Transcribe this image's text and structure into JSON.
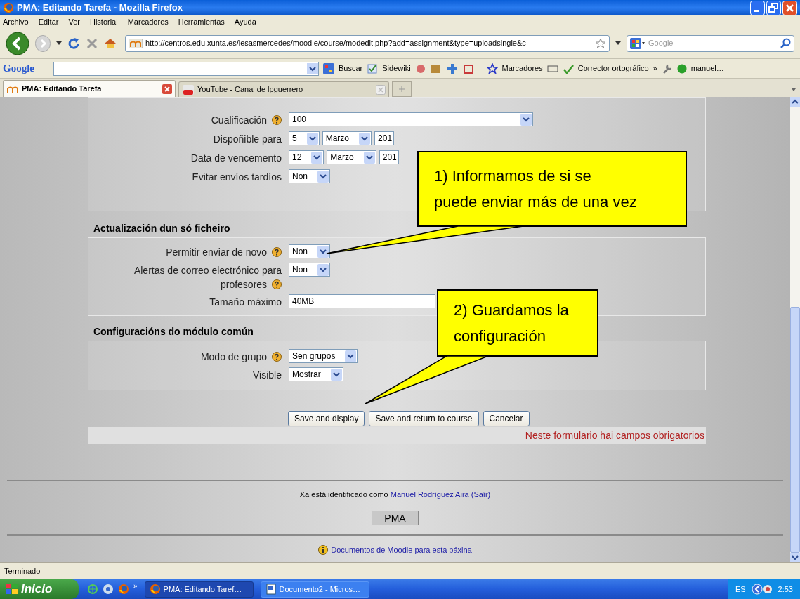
{
  "window": {
    "title": "PMA: Editando Tarefa - Mozilla Firefox"
  },
  "menu": [
    "Archivo",
    "Editar",
    "Ver",
    "Historial",
    "Marcadores",
    "Herramientas",
    "Ayuda"
  ],
  "address": {
    "value": "http://centros.edu.xunta.es/iesasmercedes/moodle/course/modedit.php?add=assignment&type=uploadsingle&c"
  },
  "search": {
    "placeholder": "Google"
  },
  "google_toolbar": {
    "logo": "Google",
    "items": [
      "Buscar",
      "Sidewiki",
      "Marcadores",
      "Corrector ortográfico",
      "»",
      "manuel…"
    ]
  },
  "tabs": [
    {
      "label": "PMA: Editando Tarefa",
      "selected": true
    },
    {
      "label": "YouTube - Canal de lpguerrero",
      "selected": false
    }
  ],
  "form": {
    "sections": [
      {
        "rows": [
          {
            "label": "Cualificación",
            "help": true,
            "fields": [
              {
                "kind": "wide-select",
                "value": "100"
              }
            ]
          },
          {
            "label": "Dispoñible para",
            "help": false,
            "fields": [
              {
                "kind": "select",
                "value": "5"
              },
              {
                "kind": "select",
                "value": "Marzo"
              },
              {
                "kind": "covered-select",
                "value": "201"
              }
            ]
          },
          {
            "label": "Data de vencemento",
            "help": false,
            "fields": [
              {
                "kind": "select",
                "value": "12"
              },
              {
                "kind": "select",
                "value": "Marzo"
              },
              {
                "kind": "covered-select",
                "value": "201"
              }
            ]
          },
          {
            "label": "Evitar envíos tardíos",
            "help": false,
            "fields": [
              {
                "kind": "select",
                "value": "Non"
              }
            ]
          }
        ]
      },
      {
        "heading": "Actualización dun só ficheiro",
        "rows": [
          {
            "label": "Permitir enviar de novo",
            "help": true,
            "fields": [
              {
                "kind": "select",
                "value": "Non"
              }
            ]
          },
          {
            "label": "Alertas de correo electrónico para profesores",
            "help": true,
            "fields": [
              {
                "kind": "select",
                "value": "Non"
              }
            ]
          },
          {
            "label": "Tamaño máximo",
            "help": false,
            "fields": [
              {
                "kind": "long-select",
                "value": "40MB"
              }
            ]
          }
        ]
      },
      {
        "heading": "Configuracións do módulo común",
        "rows": [
          {
            "label": "Modo de grupo",
            "help": true,
            "fields": [
              {
                "kind": "select",
                "value": "Sen grupos"
              }
            ]
          },
          {
            "label": "Visible",
            "help": false,
            "fields": [
              {
                "kind": "select",
                "value": "Mostrar"
              }
            ]
          }
        ]
      }
    ],
    "buttons": [
      "Save and display",
      "Save and return to course",
      "Cancelar"
    ],
    "required_note": "Neste formulario hai campos obrigatorios"
  },
  "footer": {
    "login_prefix": "Xa está identificado como",
    "user": "Manuel Rodríguez Aira",
    "logout": "(Saír)",
    "home_button": "PMA",
    "docs_link": "Documentos de Moodle para esta páxina"
  },
  "callouts": [
    {
      "lines": [
        "1) Informamos de si se",
        "puede enviar más de una vez"
      ]
    },
    {
      "lines": [
        "2) Guardamos la",
        "configuración"
      ]
    }
  ],
  "status_bar": "Terminado",
  "taskbar": {
    "start": "Inicio",
    "more": "»",
    "tasks": [
      {
        "label": "PMA: Editando Taref…",
        "selected": true
      },
      {
        "label": "Documento2 - Micros…",
        "selected": false
      }
    ],
    "language": "ES",
    "clock": "2:53"
  }
}
